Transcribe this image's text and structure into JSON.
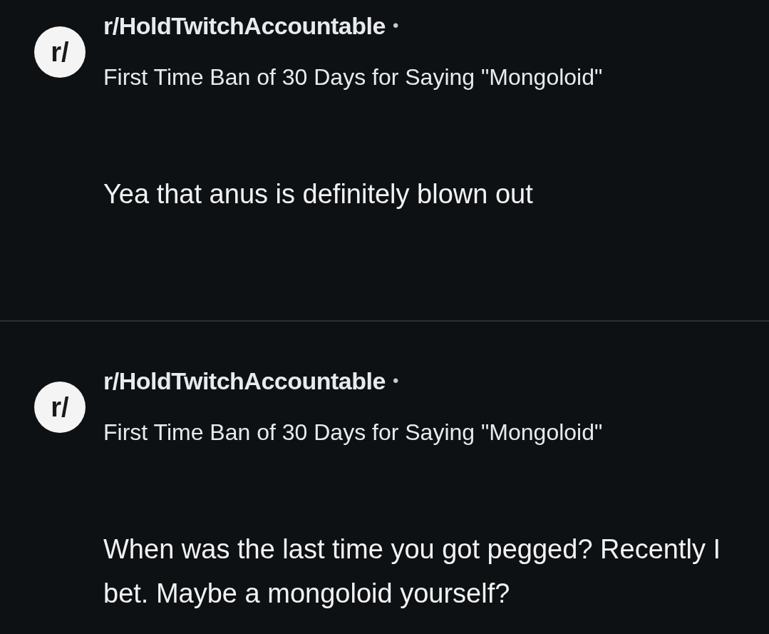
{
  "comments": [
    {
      "subreddit": "r/HoldTwitchAccountable",
      "separator": "•",
      "avatar_text": "r/",
      "post_title": "First Time Ban of 30 Days for Saying \"Mongoloid\"",
      "body": "Yea that anus is definitely blown out"
    },
    {
      "subreddit": "r/HoldTwitchAccountable",
      "separator": "•",
      "avatar_text": "r/",
      "post_title": "First Time Ban of 30 Days for Saying \"Mongoloid\"",
      "body": "When was the last time you got pegged? Recently I bet. Maybe a mongoloid yourself?"
    }
  ]
}
